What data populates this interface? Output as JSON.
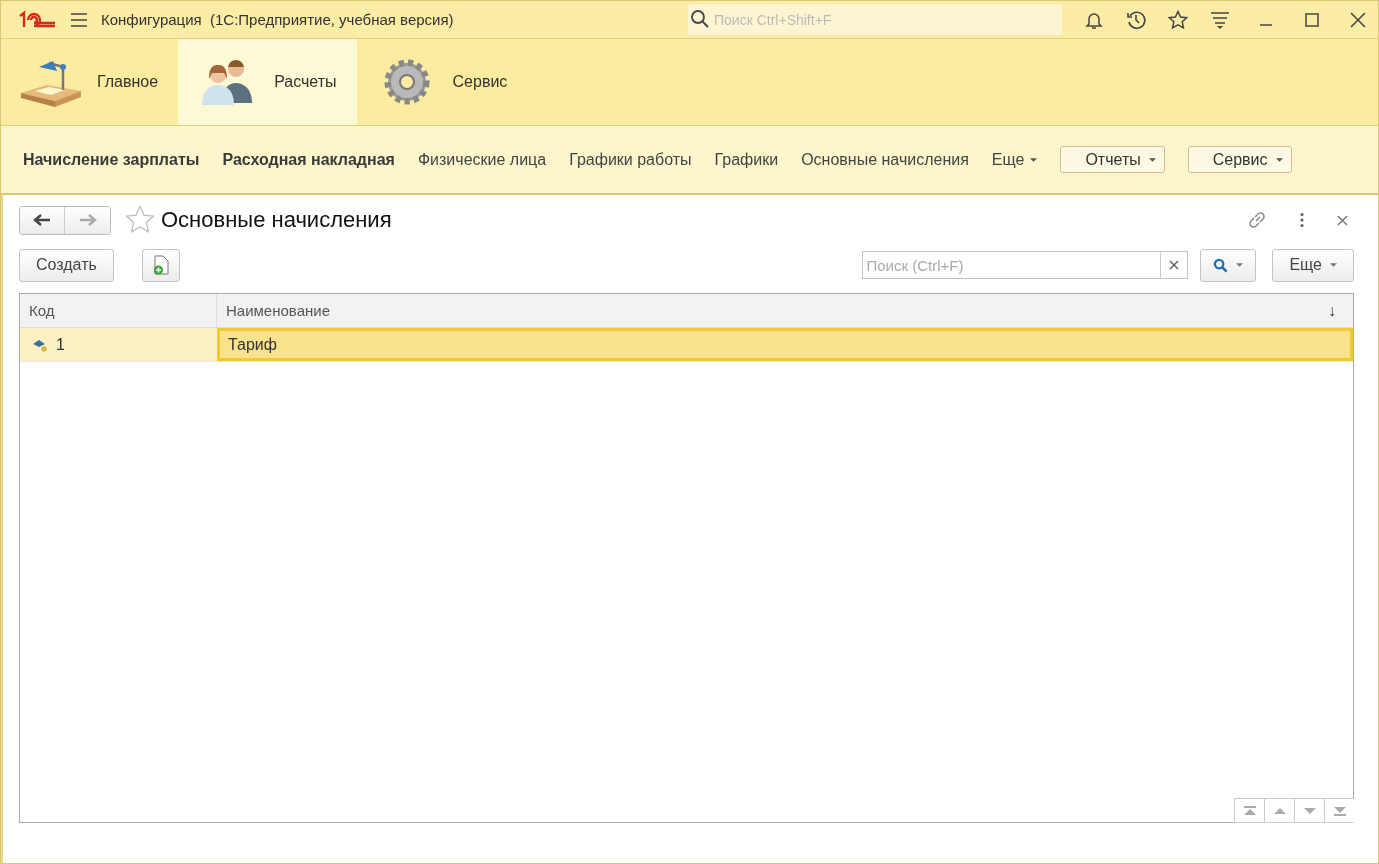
{
  "window": {
    "title": "Конфигурация  (1С:Предприятие, учебная версия)",
    "search": {
      "placeholder": "Поиск Ctrl+Shift+F"
    }
  },
  "sections": [
    {
      "label": "Главное",
      "kind": "desk",
      "selected": false
    },
    {
      "label": "Расчеты",
      "kind": "people",
      "selected": true
    },
    {
      "label": "Сервис",
      "kind": "gear",
      "selected": false
    }
  ],
  "function_panel": [
    {
      "label": "Начисление зарплаты",
      "kind": "bold"
    },
    {
      "label": "Расходная накладная",
      "kind": "bold"
    },
    {
      "label": "Физические лица",
      "kind": "plain"
    },
    {
      "label": "Графики работы",
      "kind": "plain"
    },
    {
      "label": "Графики",
      "kind": "plain"
    },
    {
      "label": "Основные начисления",
      "kind": "plain"
    },
    {
      "label": "Еще",
      "kind": "more"
    },
    {
      "label": "Отчеты",
      "kind": "button"
    },
    {
      "label": "Сервис",
      "kind": "button"
    }
  ],
  "form": {
    "title": "Основные начисления",
    "create_button": "Создать",
    "search": {
      "placeholder": "Поиск (Ctrl+F)"
    },
    "more_button": "Еще"
  },
  "table": {
    "columns": [
      {
        "label": "Код"
      },
      {
        "label": "Наименование",
        "sort": "↓"
      }
    ],
    "rows": [
      {
        "code": "1",
        "name": "Тариф",
        "selected": true
      }
    ]
  }
}
